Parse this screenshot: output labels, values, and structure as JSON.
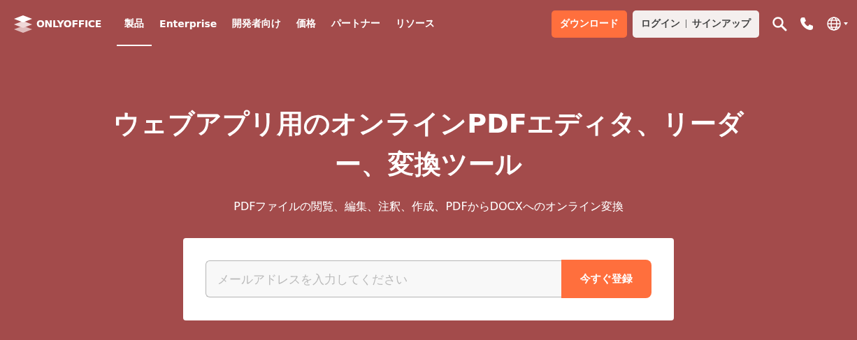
{
  "header": {
    "logo": "ONLYOFFICE",
    "nav": [
      {
        "label": "製品",
        "selected": true
      },
      {
        "label": "Enterprise",
        "selected": false
      },
      {
        "label": "開発者向け",
        "selected": false
      },
      {
        "label": "価格",
        "selected": false
      },
      {
        "label": "パートナー",
        "selected": false
      },
      {
        "label": "リソース",
        "selected": false
      }
    ],
    "download": "ダウンロード",
    "login": "ログイン",
    "signup": "サインアップ"
  },
  "hero": {
    "title": "ウェブアプリ用のオンラインPDFエディタ、リーダー、変換ツール",
    "subtitle": "PDFファイルの閲覧、編集、注釈、作成、PDFからDOCXへのオンライン変換",
    "signup_form": {
      "placeholder": "メールアドレスを入力してください",
      "button": "今すぐ登録"
    }
  }
}
